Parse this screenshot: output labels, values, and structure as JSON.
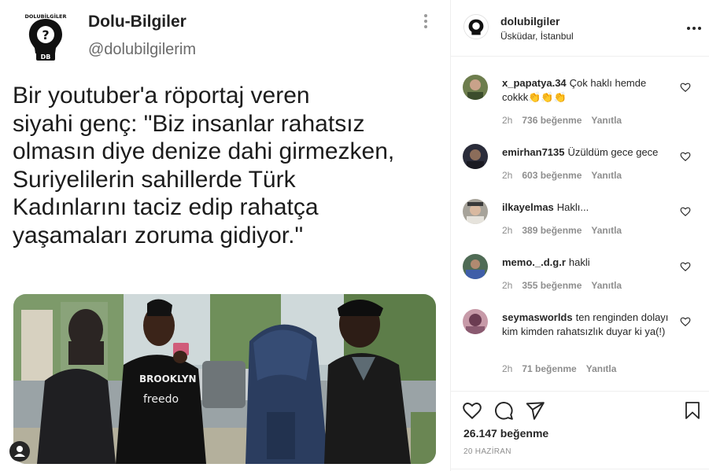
{
  "tweet": {
    "name": "Dolu-Bilgiler",
    "handle": "@dolubilgilerim",
    "logo_text": "DOLUBİLGİLER",
    "logo_badge": "DB",
    "lines": [
      "Bir youtuber'a röportaj veren",
      "siyahi genç: \"Biz insanlar rahatsız",
      "olmasın diye denize dahi girmezken,",
      "Suriyelilerin sahillerde Türk",
      "Kadınlarını taciz edip rahatça",
      "yaşamaları zoruma gidiyor.\""
    ],
    "photo_shirt_text": "freedo",
    "photo_shirt_text2": "BROOKLYN"
  },
  "header": {
    "username": "dolubilgiler",
    "location": "Üsküdar, İstanbul"
  },
  "comments": [
    {
      "user": "x_papatya.34",
      "text": "Çok haklı hemde cokkk👏👏👏",
      "time": "2h",
      "likes": "736 beğenme",
      "reply": "Yanıtla"
    },
    {
      "user": "emirhan7135",
      "text": "Üzüldüm gece gece",
      "time": "2h",
      "likes": "603 beğenme",
      "reply": "Yanıtla"
    },
    {
      "user": "ilkayelmas",
      "text": "Haklı...",
      "time": "2h",
      "likes": "389 beğenme",
      "reply": "Yanıtla"
    },
    {
      "user": "memo._.d.g.r",
      "text": "hakli",
      "time": "2h",
      "likes": "355 beğenme",
      "reply": "Yanıtla"
    },
    {
      "user": "seymasworlds",
      "text": "ten renginden dolayı kim kimden rahatsızlık duyar ki ya(!)",
      "time": "2h",
      "likes": "71 beğenme",
      "reply": "Yanıtla"
    }
  ],
  "footer": {
    "likes": "26.147 beğenme",
    "date": "20 HAZİRAN"
  },
  "icons": [
    "heart-icon",
    "comment-icon",
    "share-icon",
    "bookmark-icon",
    "more-icon",
    "user-tag-icon"
  ]
}
